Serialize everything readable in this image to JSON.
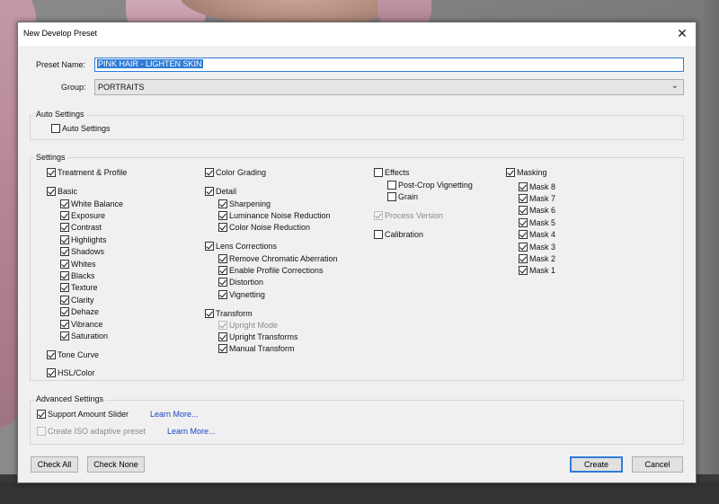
{
  "window": {
    "title": "New Develop Preset",
    "close_glyph": "✕"
  },
  "preset_name": {
    "label": "Preset Name:",
    "value": "PINK HAIR - LIGHTEN SKIN"
  },
  "group": {
    "label": "Group:",
    "value": "PORTRAITS",
    "arrow": "⌄"
  },
  "auto_settings": {
    "section": "Auto Settings",
    "item": {
      "label": "Auto Settings",
      "checked": false
    }
  },
  "settings": {
    "section": "Settings",
    "col1": {
      "treatment": {
        "label": "Treatment & Profile",
        "checked": true
      },
      "basic": {
        "label": "Basic",
        "checked": true
      },
      "basic_items": [
        {
          "label": "White Balance",
          "checked": true
        },
        {
          "label": "Exposure",
          "checked": true
        },
        {
          "label": "Contrast",
          "checked": true
        },
        {
          "label": "Highlights",
          "checked": true
        },
        {
          "label": "Shadows",
          "checked": true
        },
        {
          "label": "Whites",
          "checked": true
        },
        {
          "label": "Blacks",
          "checked": true
        },
        {
          "label": "Texture",
          "checked": true
        },
        {
          "label": "Clarity",
          "checked": true
        },
        {
          "label": "Dehaze",
          "checked": true
        },
        {
          "label": "Vibrance",
          "checked": true
        },
        {
          "label": "Saturation",
          "checked": true
        }
      ],
      "tone_curve": {
        "label": "Tone Curve",
        "checked": true
      },
      "hsl": {
        "label": "HSL/Color",
        "checked": true
      }
    },
    "col2": {
      "color_grading": {
        "label": "Color Grading",
        "checked": true
      },
      "detail": {
        "label": "Detail",
        "checked": true
      },
      "detail_items": [
        {
          "label": "Sharpening",
          "checked": true
        },
        {
          "label": "Luminance Noise Reduction",
          "checked": true
        },
        {
          "label": "Color Noise Reduction",
          "checked": true
        }
      ],
      "lens": {
        "label": "Lens Corrections",
        "checked": true
      },
      "lens_items": [
        {
          "label": "Remove Chromatic Aberration",
          "checked": true
        },
        {
          "label": "Enable Profile Corrections",
          "checked": true
        },
        {
          "label": "Distortion",
          "checked": true
        },
        {
          "label": "Vignetting",
          "checked": true
        }
      ],
      "transform": {
        "label": "Transform",
        "checked": true
      },
      "transform_items": [
        {
          "label": "Upright Mode",
          "checked": true,
          "disabled": true
        },
        {
          "label": "Upright Transforms",
          "checked": true
        },
        {
          "label": "Manual Transform",
          "checked": true
        }
      ]
    },
    "col3": {
      "effects": {
        "label": "Effects",
        "checked": false
      },
      "effects_items": [
        {
          "label": "Post-Crop Vignetting",
          "checked": false
        },
        {
          "label": "Grain",
          "checked": false
        }
      ],
      "process_version": {
        "label": "Process Version",
        "checked": true,
        "disabled": true
      },
      "calibration": {
        "label": "Calibration",
        "checked": false
      }
    },
    "col4": {
      "masking": {
        "label": "Masking",
        "checked": true
      },
      "mask_items": [
        {
          "label": "Mask 8",
          "checked": true
        },
        {
          "label": "Mask 7",
          "checked": true
        },
        {
          "label": "Mask 6",
          "checked": true
        },
        {
          "label": "Mask 5",
          "checked": true
        },
        {
          "label": "Mask 4",
          "checked": true
        },
        {
          "label": "Mask 3",
          "checked": true
        },
        {
          "label": "Mask 2",
          "checked": true
        },
        {
          "label": "Mask 1",
          "checked": true
        }
      ]
    }
  },
  "advanced": {
    "section": "Advanced Settings",
    "support_amount": {
      "label": "Support Amount Slider",
      "checked": true
    },
    "support_link": "Learn More...",
    "iso": {
      "label": "Create ISO adaptive preset",
      "checked": false,
      "disabled": true
    },
    "iso_link": "Learn More..."
  },
  "buttons": {
    "check_all": "Check All",
    "check_none": "Check None",
    "create": "Create",
    "cancel": "Cancel"
  },
  "colors": {
    "accent": "#2f7cd6",
    "link": "#1a45c9",
    "dialog_bg": "#f0f0f0"
  }
}
